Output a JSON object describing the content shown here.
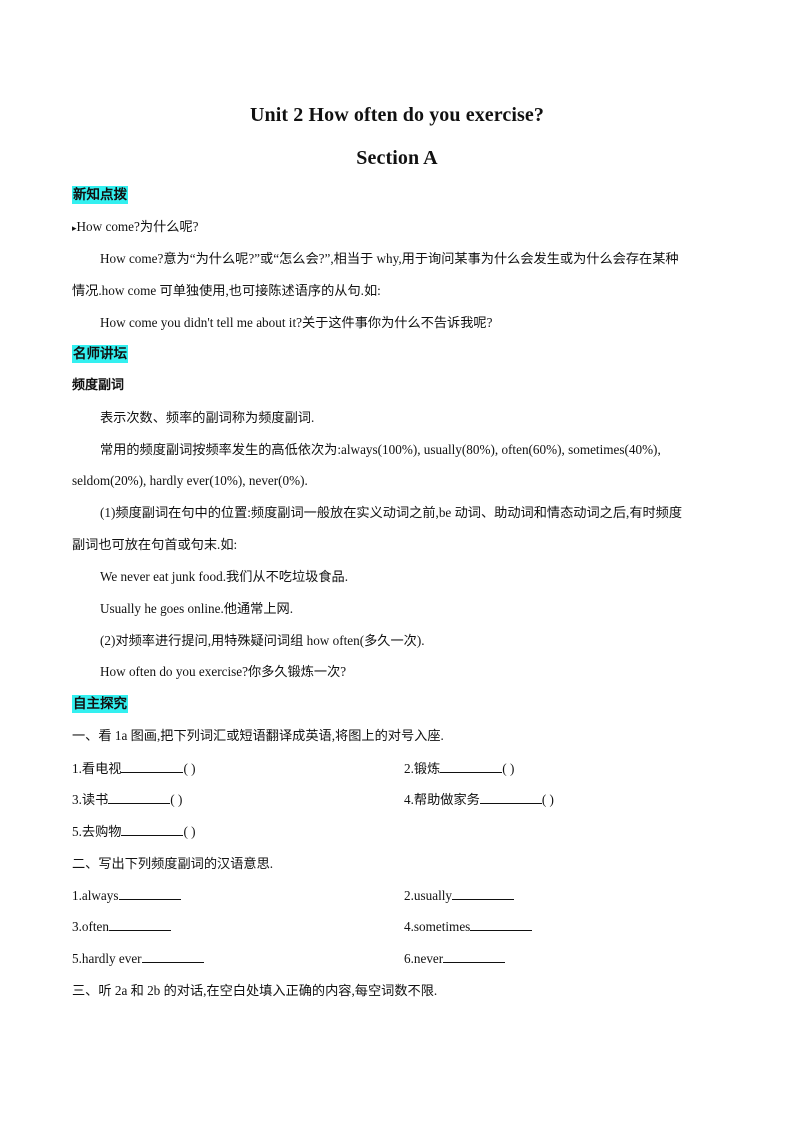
{
  "header": {
    "title": "Unit 2 How often do you exercise?",
    "subtitle": "Section A"
  },
  "section_new_knowledge": {
    "tag": "新知点拨",
    "bullet": "▸",
    "heading": "How come?为什么呢?",
    "para_line1": "How come?意为“为什么呢?”或“怎么会?”,相当于 why,用于询问某事为什么会发生或为什么会存在某种",
    "para_line2": "情况.how come 可单独使用,也可接陈述语序的从句.如:",
    "example": "How come you didn't tell me about it?关于这件事你为什么不告诉我呢?"
  },
  "section_teacher": {
    "tag": "名师讲坛",
    "heading": "频度副词",
    "def": "表示次数、频率的副词称为频度副词.",
    "list_line1": "常用的频度副词按频率发生的高低依次为:always(100%), usually(80%), often(60%), sometimes(40%),",
    "list_line2": "seldom(20%), hardly ever(10%), never(0%).",
    "rule1_line1": "(1)频度副词在句中的位置:频度副词一般放在实义动词之前,be 动词、助动词和情态动词之后,有时频度",
    "rule1_line2": "副词也可放在句首或句末.如:",
    "ex1": "We never eat junk food.我们从不吃垃圾食品.",
    "ex2": "Usually he goes online.他通常上网.",
    "rule2": "(2)对频率进行提问,用特殊疑问词组 how often(多久一次).",
    "ex3": "How often do you exercise?你多久锻炼一次?"
  },
  "section_self_study": {
    "tag": "自主探究",
    "q1_title": "一、看 1a 图画,把下列词汇或短语翻译成英语,将图上的对号入座.",
    "q1_items": [
      {
        "label": "1.看电视",
        "paren": "(    )"
      },
      {
        "label": "2.锻炼",
        "paren": "(    )"
      },
      {
        "label": "3.读书",
        "paren": "(    )"
      },
      {
        "label": "4.帮助做家务",
        "paren": "(    )"
      },
      {
        "label": "5.去购物",
        "paren": "(    )"
      }
    ],
    "q2_title": "二、写出下列频度副词的汉语意思.",
    "q2_items": [
      {
        "label": "1.always"
      },
      {
        "label": "2.usually"
      },
      {
        "label": "3.often"
      },
      {
        "label": "4.sometimes"
      },
      {
        "label": "5.hardly ever"
      },
      {
        "label": "6.never"
      }
    ],
    "q3_title": "三、听 2a 和 2b 的对话,在空白处填入正确的内容,每空词数不限."
  },
  "colors": {
    "tag_highlight": "#33f0f0",
    "text": "#111111"
  }
}
